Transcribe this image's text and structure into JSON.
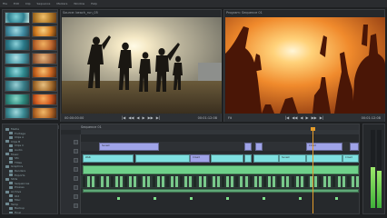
{
  "menu": [
    "File",
    "Edit",
    "Clip",
    "Sequence",
    "Markers",
    "Window",
    "Help"
  ],
  "source_viewer": {
    "title": "Source: beach_run_05",
    "timecode_left": "00:00:00:00",
    "timecode_right": "00:01:12:08",
    "controls": [
      "|◀",
      "◀◀",
      "◀",
      "▶",
      "▶▶",
      "▶|"
    ]
  },
  "program_viewer": {
    "title": "Program: Sequence 01",
    "timecode_left": "Fit",
    "timecode_right": "00:01:12:08",
    "controls": [
      "|◀",
      "◀◀",
      "◀",
      "▶",
      "▶▶",
      "▶|"
    ]
  },
  "project": {
    "items": [
      "Media",
      "Footage",
      "Clips A",
      "Clips B",
      "Clips C",
      "Audio",
      "Music",
      "Sfx",
      "Titles",
      "Graphics",
      "Renders",
      "Exports",
      "Stills",
      "Sequences",
      "Proxies",
      "Archive",
      "Old",
      "Misc",
      "Temp",
      "Backup",
      "Final"
    ]
  },
  "timeline": {
    "title": "Sequence 01",
    "clip_labels": [
      "Sunset",
      "Crowd",
      "Walk",
      "Crowd",
      "Sunset",
      "Crowd"
    ]
  },
  "colors": {
    "accent": "#e39b2b",
    "clip_purple": "#9fa3e8",
    "clip_cyan": "#7fe0e0",
    "clip_green": "#6fd08a",
    "audio_green": "#78c88a",
    "meter": "#5fd04f"
  }
}
